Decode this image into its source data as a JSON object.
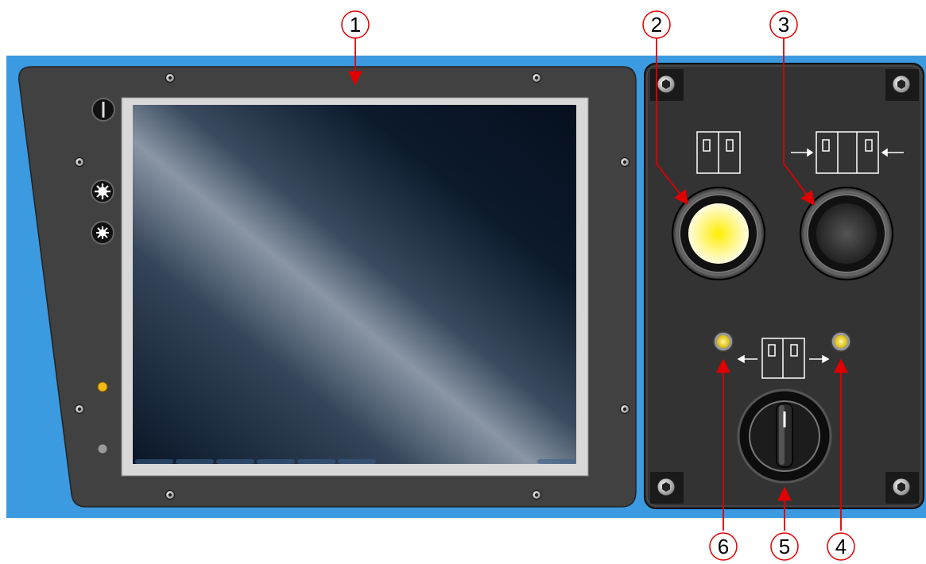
{
  "diagram": {
    "description_labels": [
      {
        "id": "1",
        "text": "1",
        "target": "display-screen"
      },
      {
        "id": "2",
        "text": "2",
        "target": "illuminated-pushbutton-open"
      },
      {
        "id": "3",
        "text": "3",
        "target": "pushbutton-close"
      },
      {
        "id": "4",
        "text": "4",
        "target": "indicator-lamp-right"
      },
      {
        "id": "5",
        "text": "5",
        "target": "key-selector-switch"
      },
      {
        "id": "6",
        "text": "6",
        "target": "indicator-lamp-left"
      }
    ],
    "colors": {
      "mounting_plate": "#3c9ae0",
      "control_panel": "#333333",
      "panel_border": "#555555",
      "callout_line": "#e00000",
      "lamp_lit": "#ffee00",
      "lamp_indicator": "#f3e020",
      "screen_dark": "#0a1628"
    },
    "icons": [
      "door-open-icon",
      "door-close-icon",
      "door-open-direction-icon",
      "brightness-up-icon",
      "brightness-down-icon",
      "power-icon",
      "hex-socket-screw-icon"
    ],
    "states": {
      "pushbutton_open_lit": true,
      "pushbutton_close_lit": false,
      "indicator_left_lit": true,
      "indicator_right_lit": true,
      "status_led_upper_lit": true,
      "status_led_lower_lit": false
    }
  }
}
